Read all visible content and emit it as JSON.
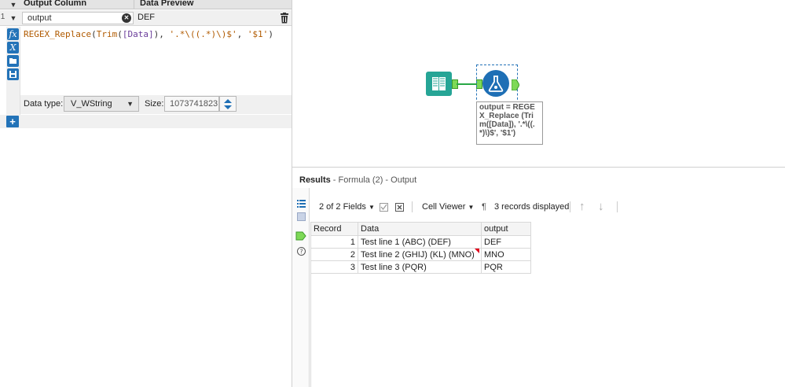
{
  "config": {
    "header": {
      "col_output": "Output Column",
      "col_preview": "Data Preview"
    },
    "row": {
      "row_number": "1",
      "output_name": "output",
      "preview_value": "DEF"
    },
    "tool_buttons": [
      "fx-icon",
      "variable-icon",
      "folder-icon",
      "save-icon"
    ],
    "expression": {
      "fn_replace": "REGEX_Replace",
      "p1": "(",
      "fn_trim": "Trim",
      "p2": "(",
      "field": "[Data]",
      "p3": "), ",
      "pattern": "'.*\\((.*)\\)$'",
      "comma": ", ",
      "replacement": "'$1'",
      "p4": ")"
    },
    "data_type_label": "Data type:",
    "data_type_value": "V_WString",
    "size_label": "Size:",
    "size_value": "1073741823"
  },
  "canvas": {
    "annotation": "output = REGEX_Replace (Trim([Data]), '.*\\((.*)\\)$', '$1')"
  },
  "results": {
    "title": "Results",
    "subtitle": " - Formula (2) - Output",
    "fields_selector": "2 of 2 Fields",
    "viewer": "Cell Viewer",
    "records_label": "3 records displayed",
    "columns": [
      "Record",
      "Data",
      "output"
    ],
    "rows": [
      {
        "record": "1",
        "data": "Test line 1 (ABC) (DEF)",
        "output": "DEF"
      },
      {
        "record": "2",
        "data": "Test line 2 (GHIJ) (KL) (MNO)",
        "output": "MNO"
      },
      {
        "record": "3",
        "data": "Test line 3 (PQR)",
        "output": "PQR"
      }
    ]
  },
  "colors": {
    "accent": "#2373b8",
    "input_tool": "#26a596",
    "connector": "#28a745"
  }
}
